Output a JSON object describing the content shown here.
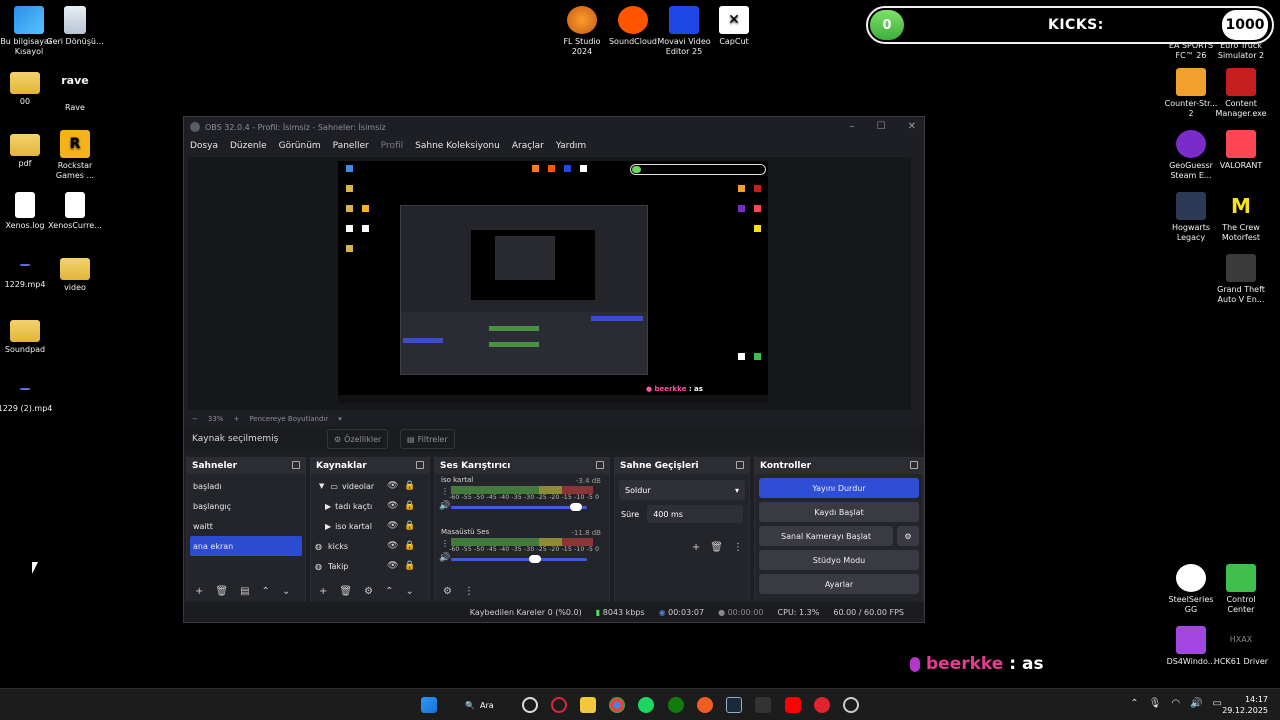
{
  "desktop": {
    "left_icons": [
      {
        "label": "Bu bilgisayar - Kısayol",
        "icon": "computer-icon"
      },
      {
        "label": "Geri Dönüşü...",
        "icon": "recycle-bin-icon"
      },
      {
        "label": "00",
        "icon": "folder-icon"
      },
      {
        "label": "Rave",
        "icon": "rave-icon"
      },
      {
        "label": "pdf",
        "icon": "folder-icon"
      },
      {
        "label": "Rockstar Games ...",
        "icon": "rockstar-icon"
      },
      {
        "label": "Xenos.log",
        "icon": "file-icon"
      },
      {
        "label": "XenosCurre...",
        "icon": "file-icon"
      },
      {
        "label": "1229.mp4",
        "icon": "video-file-icon"
      },
      {
        "label": "video",
        "icon": "folder-icon"
      },
      {
        "label": "Soundpad",
        "icon": "folder-icon"
      },
      {
        "label": "1229 (2).mp4",
        "icon": "video-file-icon"
      }
    ],
    "top_icons": [
      {
        "label": "FL Studio 2024",
        "icon": "fl-studio-icon"
      },
      {
        "label": "SoundCloud",
        "icon": "soundcloud-icon"
      },
      {
        "label": "Movavi Video Editor 25",
        "icon": "movavi-icon"
      },
      {
        "label": "CapCut",
        "icon": "capcut-icon"
      }
    ],
    "right_icons": [
      {
        "label": "EA SPORTS FC™ 26",
        "icon": "ea-fc-icon"
      },
      {
        "label": "Euro Truck Simulator 2",
        "icon": "ets2-icon"
      },
      {
        "label": "Counter-Str... 2",
        "icon": "cs2-icon"
      },
      {
        "label": "Content Manager.exe",
        "icon": "content-manager-icon"
      },
      {
        "label": "GeoGuessr Steam E...",
        "icon": "geoguessr-icon"
      },
      {
        "label": "VALORANT",
        "icon": "valorant-icon"
      },
      {
        "label": "Hogwarts Legacy",
        "icon": "hogwarts-icon"
      },
      {
        "label": "The Crew Motorfest",
        "icon": "the-crew-icon"
      },
      {
        "label": "Grand Theft Auto V En...",
        "icon": "gta-icon"
      },
      {
        "label": "SteelSeries GG",
        "icon": "steelseries-icon"
      },
      {
        "label": "Control Center",
        "icon": "control-center-icon"
      },
      {
        "label": "DS4Windo...",
        "icon": "ds4windows-icon"
      },
      {
        "label": "HCK61 Driver",
        "icon": "hck61-icon"
      }
    ]
  },
  "kicks_overlay": {
    "count": "0",
    "label": "KICKS:",
    "goal": "1000"
  },
  "obs": {
    "title": "OBS 32.0.4 - Profil: İsimsiz - Sahneler: İsimsiz",
    "menu": [
      "Dosya",
      "Düzenle",
      "Görünüm",
      "Paneller",
      "Profil",
      "Sahne Koleksiyonu",
      "Araçlar",
      "Yardım"
    ],
    "zoom": "33%",
    "fit_label": "Pencereye Boyutlandır",
    "no_source": "Kaynak seçilmemiş",
    "properties": "Özellikler",
    "filters": "Filtreler",
    "scenes": {
      "title": "Sahneler",
      "items": [
        "başladı",
        "başlangıç",
        "waitt",
        "ana ekran"
      ],
      "selected": 3
    },
    "sources": {
      "title": "Kaynaklar",
      "items": [
        {
          "name": "videolar",
          "type": "group"
        },
        {
          "name": "tadı kaçtı",
          "type": "media"
        },
        {
          "name": "iso kartal",
          "type": "media"
        },
        {
          "name": "kicks",
          "type": "browser"
        },
        {
          "name": "Takip",
          "type": "browser"
        }
      ]
    },
    "mixer": {
      "title": "Ses Karıştırıcı",
      "ticks": "-60 -55 -50 -45 -40 -35 -30 -25 -20 -15 -10 -5 0",
      "channels": [
        {
          "name": "iso kartal",
          "db": "-3.4 dB",
          "level": 0.92
        },
        {
          "name": "Masaüstü Ses",
          "db": "-11.8 dB",
          "level": 0.62
        }
      ]
    },
    "transitions": {
      "title": "Sahne Geçişleri",
      "type": "Soldur",
      "duration_label": "Süre",
      "duration": "400 ms"
    },
    "controls": {
      "title": "Kontroller",
      "buttons": [
        "Yayını Durdur",
        "Kaydı Başlat",
        "Sanal Kamerayı Başlat",
        "Stüdyo Modu",
        "Ayarlar"
      ]
    },
    "status": {
      "dropped": "Kaybedilen Kareler 0 (%0.0)",
      "bitrate": "8043 kbps",
      "stream_time": "00:03:07",
      "rec_time": "00:00:00",
      "cpu": "CPU: 1.3%",
      "fps": "60.00 / 60.00 FPS"
    }
  },
  "beer_overlay": {
    "name": "beerkke",
    "suffix": ": as"
  },
  "taskbar": {
    "search": "Ara",
    "time": "14:17",
    "date": "29.12.2025"
  }
}
